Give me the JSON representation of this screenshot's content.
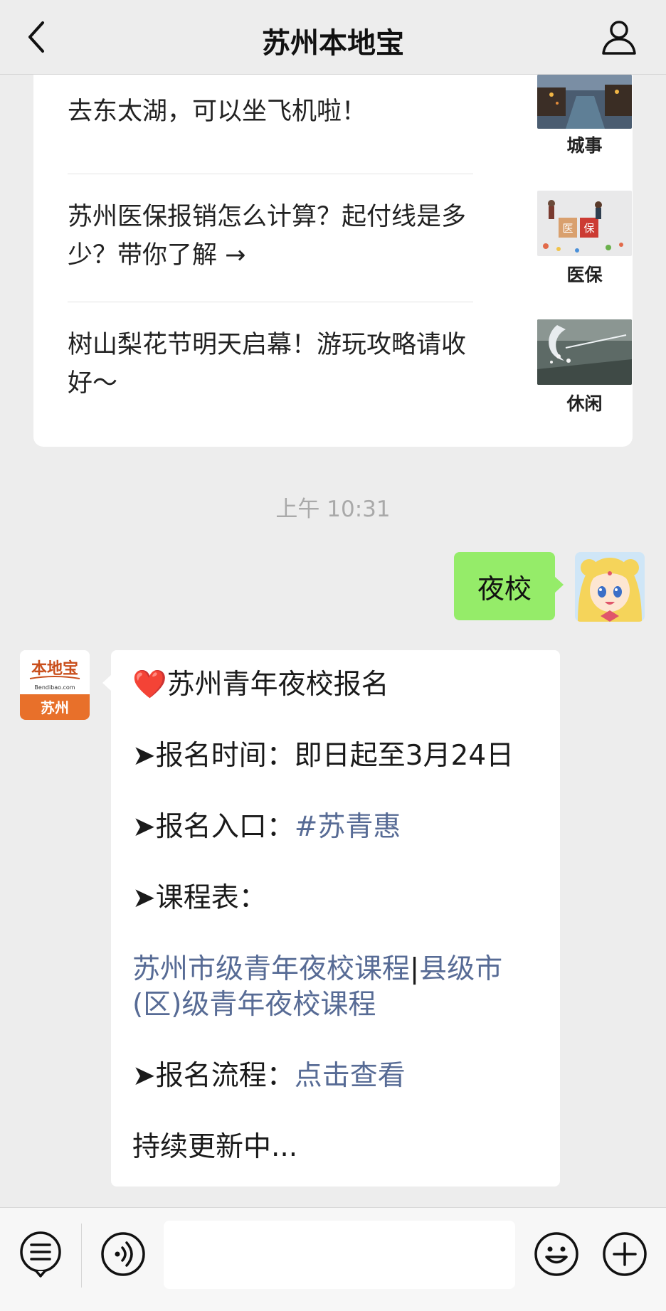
{
  "header": {
    "title": "苏州本地宝",
    "back_icon": "chevron-left-icon",
    "profile_icon": "person-icon"
  },
  "articles": [
    {
      "title": "去东太湖，可以坐飞机啦！",
      "tag": "城事"
    },
    {
      "title": "苏州医保报销怎么计算？起付线是多少？带你了解 →",
      "tag": "医保",
      "thumb_text": [
        "医",
        "保"
      ]
    },
    {
      "title": "树山梨花节明天启幕！游玩攻略请收好～",
      "tag": "休闲"
    }
  ],
  "timestamp": "上午 10:31",
  "sent_message": "夜校",
  "bot_avatar": {
    "brand": "本地宝",
    "domain": "Bendibao.com",
    "city": "苏州"
  },
  "reply": {
    "heart": "❤️",
    "title": "苏州青年夜校报名",
    "arrow": "➤",
    "time_label": "报名时间：",
    "time_value": "即日起至3月24日",
    "entry_label": "报名入口：",
    "entry_link": "#苏青惠",
    "schedule_label": "课程表：",
    "schedule_link1": "苏州市级青年夜校课程",
    "schedule_sep": "|",
    "schedule_link2": "县级市(区)级青年夜校课程",
    "process_label": "报名流程：",
    "process_link": "点击查看",
    "footer": "持续更新中..."
  },
  "colors": {
    "background": "#ededed",
    "sent_bubble": "#95ec69",
    "link": "#576b95",
    "brand_orange": "#e8702a"
  },
  "bottom_bar": {
    "menu_icon": "list-menu-icon",
    "voice_icon": "voice-icon",
    "emoji_icon": "emoji-icon",
    "plus_icon": "plus-icon"
  }
}
